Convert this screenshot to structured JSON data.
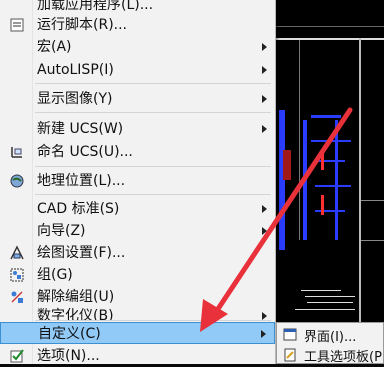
{
  "menu": {
    "items": [
      {
        "label": "加载应用程序(L)...",
        "has_submenu": false,
        "icon": "app-load-icon"
      },
      {
        "label": "运行脚本(R)...",
        "has_submenu": false,
        "icon": "script-icon"
      },
      {
        "label": "宏(A)",
        "has_submenu": true,
        "icon": ""
      },
      {
        "label": "AutoLISP(I)",
        "has_submenu": true,
        "icon": ""
      },
      {
        "label": "显示图像(Y)",
        "has_submenu": true,
        "icon": ""
      },
      {
        "label": "新建 UCS(W)",
        "has_submenu": true,
        "icon": ""
      },
      {
        "label": "命名 UCS(U)...",
        "has_submenu": false,
        "icon": "named-ucs-icon"
      },
      {
        "label": "地理位置(L)...",
        "has_submenu": false,
        "icon": "geolocation-icon"
      },
      {
        "label": "CAD 标准(S)",
        "has_submenu": true,
        "icon": ""
      },
      {
        "label": "向导(Z)",
        "has_submenu": true,
        "icon": ""
      },
      {
        "label": "绘图设置(F)...",
        "has_submenu": false,
        "icon": "drafting-settings-icon"
      },
      {
        "label": "组(G)",
        "has_submenu": false,
        "icon": "group-icon"
      },
      {
        "label": "解除编组(U)",
        "has_submenu": false,
        "icon": "ungroup-icon"
      },
      {
        "label": "数字化仪(B)",
        "has_submenu": true,
        "icon": ""
      },
      {
        "label": "自定义(C)",
        "has_submenu": true,
        "icon": "",
        "highlighted": true
      },
      {
        "label": "选项(N)...",
        "has_submenu": false,
        "icon": "checkbox-options-icon"
      }
    ]
  },
  "submenu": {
    "items": [
      {
        "label": "界面(I)...",
        "icon": "interface-icon"
      },
      {
        "label": "工具选项板(P",
        "icon": "tool-palette-icon"
      }
    ]
  },
  "colors": {
    "highlight": "#91c9f7",
    "annotation_arrow": "#e8313a"
  }
}
